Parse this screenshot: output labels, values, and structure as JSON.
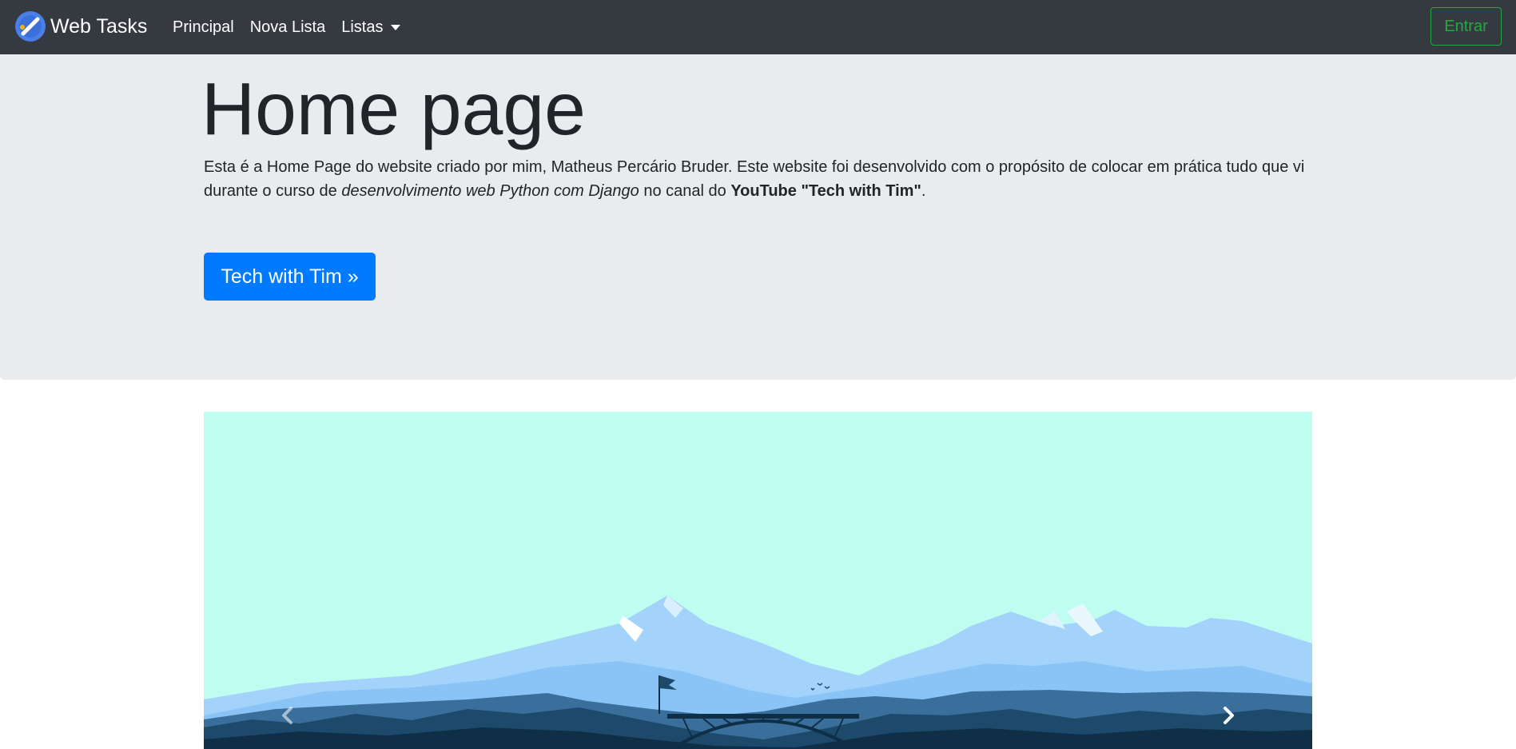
{
  "navbar": {
    "brand": "Web Tasks",
    "links": [
      {
        "label": "Principal"
      },
      {
        "label": "Nova Lista"
      },
      {
        "label": "Listas"
      }
    ],
    "login_label": "Entrar"
  },
  "jumbotron": {
    "title": "Home page",
    "lead_part1": "Esta é a Home Page do website criado por mim, Matheus Percário Bruder. Este website foi desenvolvido com o propósito de colocar em prática tudo que vi durante o curso de ",
    "lead_italic": "desenvolvimento web Python com Django",
    "lead_part2": " no canal do ",
    "lead_bold": "YouTube \"Tech with Tim\"",
    "lead_end": ".",
    "button_label": "Tech with Tim »"
  },
  "carousel": {
    "prev_icon": "chevron-left-icon",
    "next_icon": "chevron-right-icon"
  },
  "colors": {
    "navbar_bg": "#343a40",
    "jumbotron_bg": "#e9ecef",
    "primary": "#007bff",
    "success": "#28a745",
    "sky": "#c0fdf1"
  }
}
